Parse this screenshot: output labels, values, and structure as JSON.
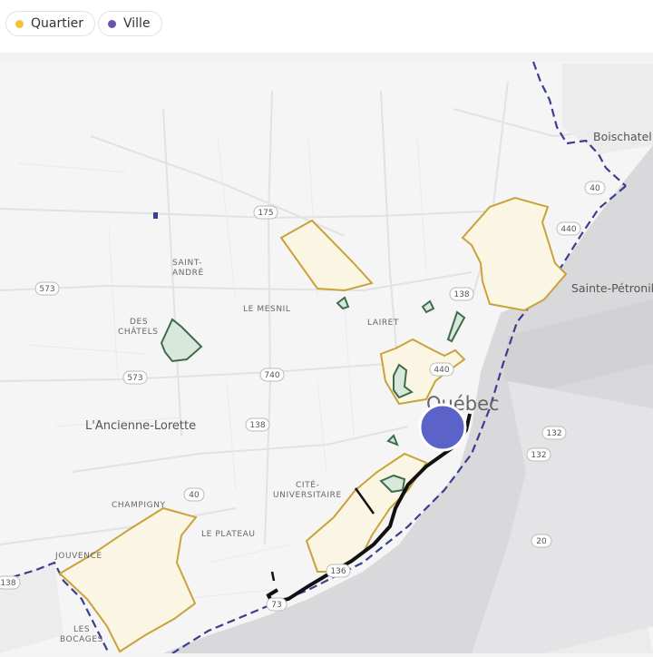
{
  "legend": [
    {
      "label": "Quartier",
      "color": "#f2c23b"
    },
    {
      "label": "Ville",
      "color": "#6a55a8"
    }
  ],
  "map": {
    "city_label": "Québec",
    "place_labels": {
      "boischatel": "Boischatel",
      "sainte_petronille": "Sainte-Pétronill",
      "saint_andre_1": "SAINT-",
      "saint_andre_2": "ANDRÉ",
      "le_mesnil": "LE MESNIL",
      "lairet": "LAIRET",
      "des_chatels_1": "DES",
      "des_chatels_2": "CHÂTELS",
      "ancienne_lorette": "L'Ancienne-Lorette",
      "cite_univ_1": "CITÉ-",
      "cite_univ_2": "UNIVERSITAIRE",
      "champigny": "CHAMPIGNY",
      "le_plateau": "LE PLATEAU",
      "jouvence": "JOUVENCE",
      "les_bocages_1": "LES",
      "les_bocages_2": "BOCAGES"
    },
    "route_shields": {
      "r175": "175",
      "r573a": "573",
      "r573b": "573",
      "r740": "740",
      "r138a": "138",
      "r138b": "138",
      "r440a": "440",
      "r440b": "440",
      "r40a": "40",
      "r40b": "40",
      "r132a": "132",
      "r132b": "132",
      "r20": "20",
      "r136": "136",
      "r73": "73",
      "r138c": "138"
    },
    "colors": {
      "quartier_fill": "#fbf6e4",
      "quartier_stroke": "#c9a23a",
      "park_fill": "#d9e8dd",
      "park_stroke": "#3f6b4c",
      "river": "#d9d9db",
      "boundary": "#3b3f8f",
      "marker": "#5b63c9"
    }
  }
}
